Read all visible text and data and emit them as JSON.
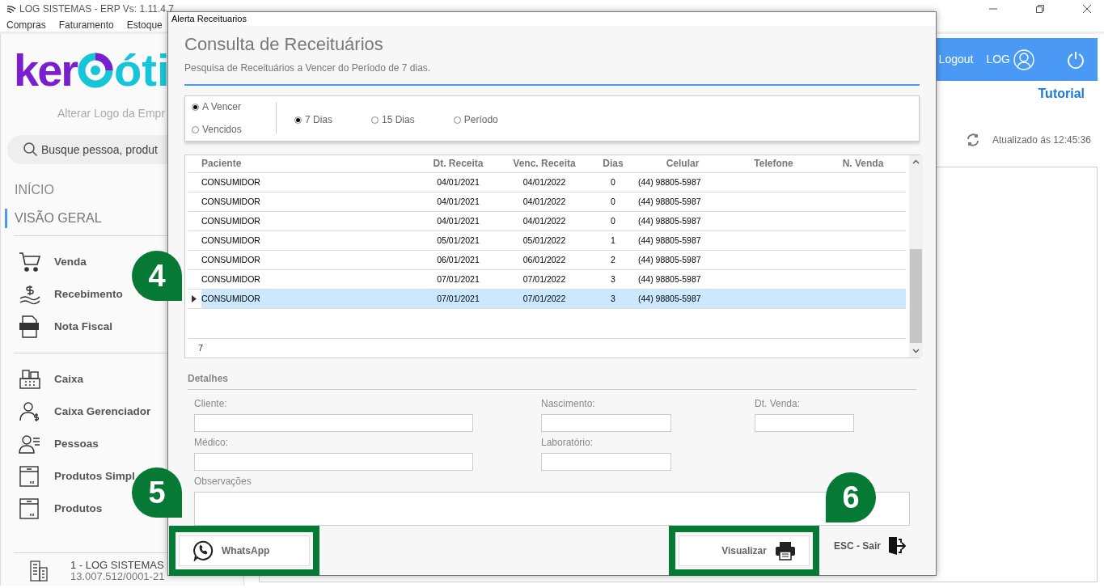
{
  "app": {
    "title": "LOG SISTEMAS - ERP Vs: 1.11.4.7",
    "menu": [
      "Compras",
      "Faturamento",
      "Estoque"
    ]
  },
  "sidebar": {
    "logo": {
      "part_a": "ker",
      "part_b": "óti"
    },
    "change_logo": "Alterar Logo da Empr",
    "search": {
      "placeholder": "Busque pessoa, produt"
    },
    "sections": [
      {
        "label": "INÍCIO",
        "selected": false
      },
      {
        "label": "VISÃO GERAL",
        "selected": true
      }
    ],
    "groups": [
      [
        {
          "label": "Venda"
        },
        {
          "label": "Recebimento"
        },
        {
          "label": "Nota Fiscal"
        }
      ],
      [
        {
          "label": "Caixa"
        },
        {
          "label": "Caixa Gerenciador"
        },
        {
          "label": "Pessoas"
        },
        {
          "label": "Produtos Simpl"
        },
        {
          "label": "Produtos"
        }
      ]
    ],
    "company": {
      "name": "1 - LOG SISTEMAS",
      "cnpj": "13.007.512/0001-21"
    }
  },
  "header": {
    "logout": "Logout",
    "user": "LOG",
    "tutorial": "Tutorial",
    "updated": "Atualizado ás 12:45:36"
  },
  "dialog": {
    "title": "Alerta Receituarios",
    "heading": "Consulta de Receituários",
    "subtitle": "Pesquisa de Receituários a Vencer do Período de 7 dias.",
    "status_options": [
      {
        "label": "A Vencer",
        "selected": true
      },
      {
        "label": "Vencidos",
        "selected": false
      }
    ],
    "period_options": [
      {
        "label": "7 Dias",
        "selected": true
      },
      {
        "label": "15 Dias",
        "selected": false
      },
      {
        "label": "Período",
        "selected": false
      }
    ],
    "table": {
      "columns": [
        "Paciente",
        "Dt. Receita",
        "Venc. Receita",
        "Dias",
        "Celular",
        "Telefone",
        "N. Venda"
      ],
      "rows": [
        {
          "cells": [
            "CONSUMIDOR",
            "04/01/2021",
            "04/01/2022",
            "0",
            "(44) 98805-5987"
          ],
          "selected": false
        },
        {
          "cells": [
            "CONSUMIDOR",
            "04/01/2021",
            "04/01/2022",
            "0",
            "(44) 98805-5987"
          ],
          "selected": false
        },
        {
          "cells": [
            "CONSUMIDOR",
            "04/01/2021",
            "04/01/2022",
            "0",
            "(44) 98805-5987"
          ],
          "selected": false
        },
        {
          "cells": [
            "CONSUMIDOR",
            "05/01/2021",
            "05/01/2022",
            "1",
            "(44) 98805-5987"
          ],
          "selected": false
        },
        {
          "cells": [
            "CONSUMIDOR",
            "06/01/2021",
            "06/01/2022",
            "2",
            "(44) 98805-5987"
          ],
          "selected": false
        },
        {
          "cells": [
            "CONSUMIDOR",
            "07/01/2021",
            "07/01/2022",
            "3",
            "(44) 98805-5987"
          ],
          "selected": false
        },
        {
          "cells": [
            "CONSUMIDOR",
            "07/01/2021",
            "07/01/2022",
            "3",
            "(44) 98805-5987"
          ],
          "selected": true
        }
      ],
      "count": "7"
    },
    "details": {
      "title": "Detalhes",
      "fields": [
        "Cliente:",
        "Nascimento:",
        "Dt. Venda:",
        "Médico:",
        "Laboratório:",
        "Observações"
      ]
    },
    "buttons": [
      {
        "kind": "whatsapp",
        "label": "WhatsApp",
        "highlighted": true
      },
      {
        "kind": "print",
        "label": "Visualizar",
        "highlighted": true
      },
      {
        "kind": "exit",
        "label": "ESC - Sair",
        "highlighted": false
      }
    ]
  },
  "callouts": [
    {
      "number": "4"
    },
    {
      "number": "5"
    },
    {
      "number": "6"
    }
  ]
}
